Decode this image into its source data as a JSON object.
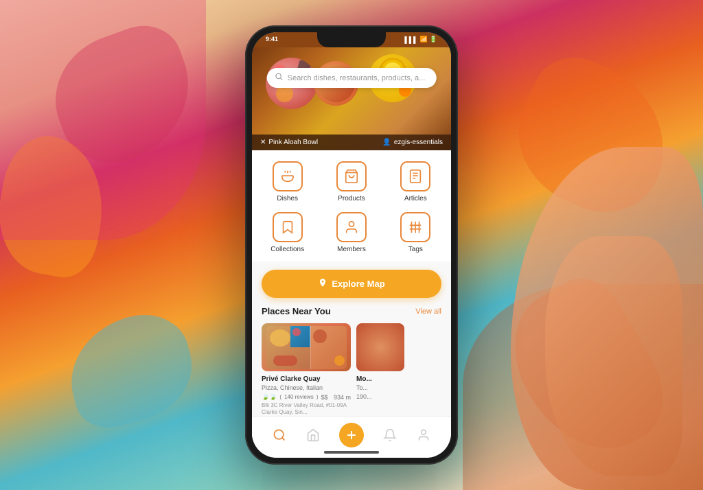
{
  "background": {
    "gradient": "colorful abstract graffiti style"
  },
  "phone": {
    "status_bar": {
      "time": "9:41",
      "signal": "●●●",
      "wifi": "WiFi",
      "battery": "■■■"
    },
    "search": {
      "placeholder": "Search dishes, restaurants, products, a..."
    },
    "restaurant_bar": {
      "dish_name": "Pink Aloah Bowl",
      "user_name": "ezgis-essentials",
      "fork_icon": "✕",
      "user_icon": "👤"
    },
    "categories": [
      {
        "id": "dishes",
        "label": "Dishes",
        "icon": "cutlery"
      },
      {
        "id": "products",
        "label": "Products",
        "icon": "cart"
      },
      {
        "id": "articles",
        "label": "Articles",
        "icon": "document"
      },
      {
        "id": "collections",
        "label": "Collections",
        "icon": "bookmark"
      },
      {
        "id": "members",
        "label": "Members",
        "icon": "person"
      },
      {
        "id": "tags",
        "label": "Tags",
        "icon": "hash"
      }
    ],
    "explore_btn": {
      "label": "Explore Map",
      "icon": "pin"
    },
    "places_section": {
      "title": "Places Near You",
      "view_all": "View all",
      "places": [
        {
          "name": "Privé Clarke Quay",
          "cuisine": "Pizza, Chinese, Italian",
          "reviews": "140 reviews",
          "price": "$$",
          "distance": "934 m",
          "address": "Blk 3C River Valley Road, #01-09A Clarke Quay, Sin...",
          "color1": "#c8a060",
          "color2": "#e07050",
          "color3": "#3090c0"
        },
        {
          "name": "Mo...",
          "cuisine": "To...",
          "reviews": "",
          "price": "",
          "distance": "190...",
          "address": "",
          "color1": "#d08050"
        }
      ]
    },
    "bottom_nav": [
      {
        "id": "search",
        "icon": "search",
        "active": true
      },
      {
        "id": "home",
        "icon": "home",
        "active": false
      },
      {
        "id": "add",
        "icon": "plus",
        "active": false,
        "special": true
      },
      {
        "id": "bell",
        "icon": "bell",
        "active": false
      },
      {
        "id": "profile",
        "icon": "person",
        "active": false
      }
    ]
  }
}
